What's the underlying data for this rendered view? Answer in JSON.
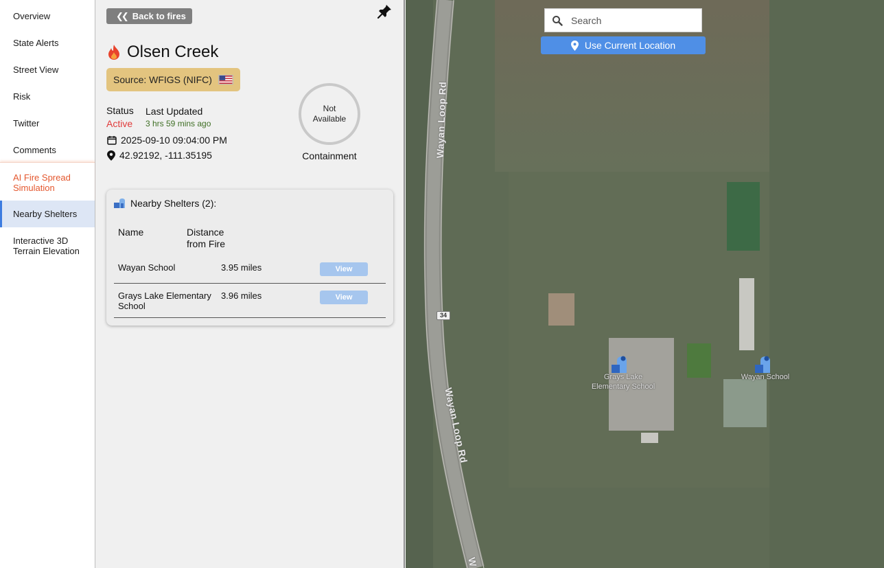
{
  "nav": {
    "items": [
      {
        "label": "Overview"
      },
      {
        "label": "State Alerts"
      },
      {
        "label": "Street View"
      },
      {
        "label": "Risk"
      },
      {
        "label": "Twitter"
      },
      {
        "label": "Comments"
      },
      {
        "label": "AI Fire Spread Simulation"
      },
      {
        "label": "Nearby Shelters"
      },
      {
        "label": "Interactive 3D Terrain Elevation"
      }
    ],
    "active": "Nearby Shelters"
  },
  "panel": {
    "back_label": "Back to fires",
    "fire_name": "Olsen Creek",
    "source_label": "Source: WFIGS (NIFC)",
    "status_label": "Status",
    "status_value": "Active",
    "last_updated_label": "Last Updated",
    "last_updated_value": "3 hrs 59 mins ago",
    "datetime": "2025-09-10 09:04:00 PM",
    "coordinates": "42.92192, -111.35195",
    "containment_value": "Not Available",
    "containment_label": "Containment"
  },
  "shelters": {
    "title": "Nearby Shelters (2):",
    "col_name": "Name",
    "col_distance": "Distance from Fire",
    "rows": [
      {
        "name": "Wayan School",
        "distance": "3.95 miles",
        "action": "View"
      },
      {
        "name": "Grays Lake Elementary School",
        "distance": "3.96 miles",
        "action": "View"
      }
    ]
  },
  "map": {
    "search_placeholder": "Search",
    "use_location_label": "Use Current Location",
    "road_label": "Wayan Loop Rd",
    "road_label_cut": "W",
    "route_shield": "34",
    "places": [
      {
        "label": "Grays Lake Elementary School"
      },
      {
        "label": "Wayan School"
      }
    ]
  },
  "colors": {
    "accent": "#4f8fe6",
    "source_badge": "#e3c47f",
    "status_active": "#e03a3a",
    "ai_nav": "#e4572e"
  }
}
